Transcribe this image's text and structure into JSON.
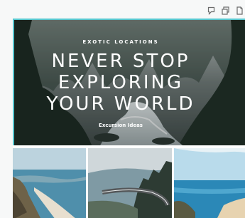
{
  "toolbar": {
    "buttons": [
      {
        "icon": "comment-icon"
      },
      {
        "icon": "duplicate-icon"
      },
      {
        "icon": "add-page-icon"
      }
    ]
  },
  "hero": {
    "eyebrow": "EXOTIC LOCATIONS",
    "headline_lines": [
      "NEVER STOP",
      "EXPLORING",
      "YOUR WORLD"
    ],
    "caption": "Excursion Ideas"
  },
  "photos": [
    {
      "subject": "coastline-cliffs"
    },
    {
      "subject": "mountain-road"
    },
    {
      "subject": "beach-bay"
    }
  ],
  "colors": {
    "selection": "#56c7cf",
    "hero_text": "#ffffff"
  }
}
